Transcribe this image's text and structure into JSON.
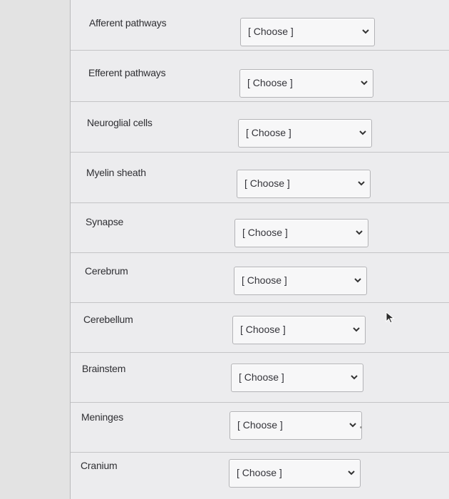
{
  "placeholder": "[ Choose ]",
  "rows": [
    {
      "label": "Afferent pathways",
      "value": "[ Choose ]"
    },
    {
      "label": "Efferent pathways",
      "value": "[ Choose ]"
    },
    {
      "label": "Neuroglial cells",
      "value": "[ Choose ]"
    },
    {
      "label": "Myelin sheath",
      "value": "[ Choose ]"
    },
    {
      "label": "Synapse",
      "value": "[ Choose ]"
    },
    {
      "label": "Cerebrum",
      "value": "[ Choose ]"
    },
    {
      "label": "Cerebellum",
      "value": "[ Choose ]"
    },
    {
      "label": "Brainstem",
      "value": "[ Choose ]"
    },
    {
      "label": "Meninges",
      "value": "[ Choose ]"
    },
    {
      "label": "Cranium",
      "value": "[ Choose ]"
    }
  ],
  "icons": {
    "dropdown": "chevron-down-icon",
    "pointer": "cursor-arrow-icon"
  }
}
